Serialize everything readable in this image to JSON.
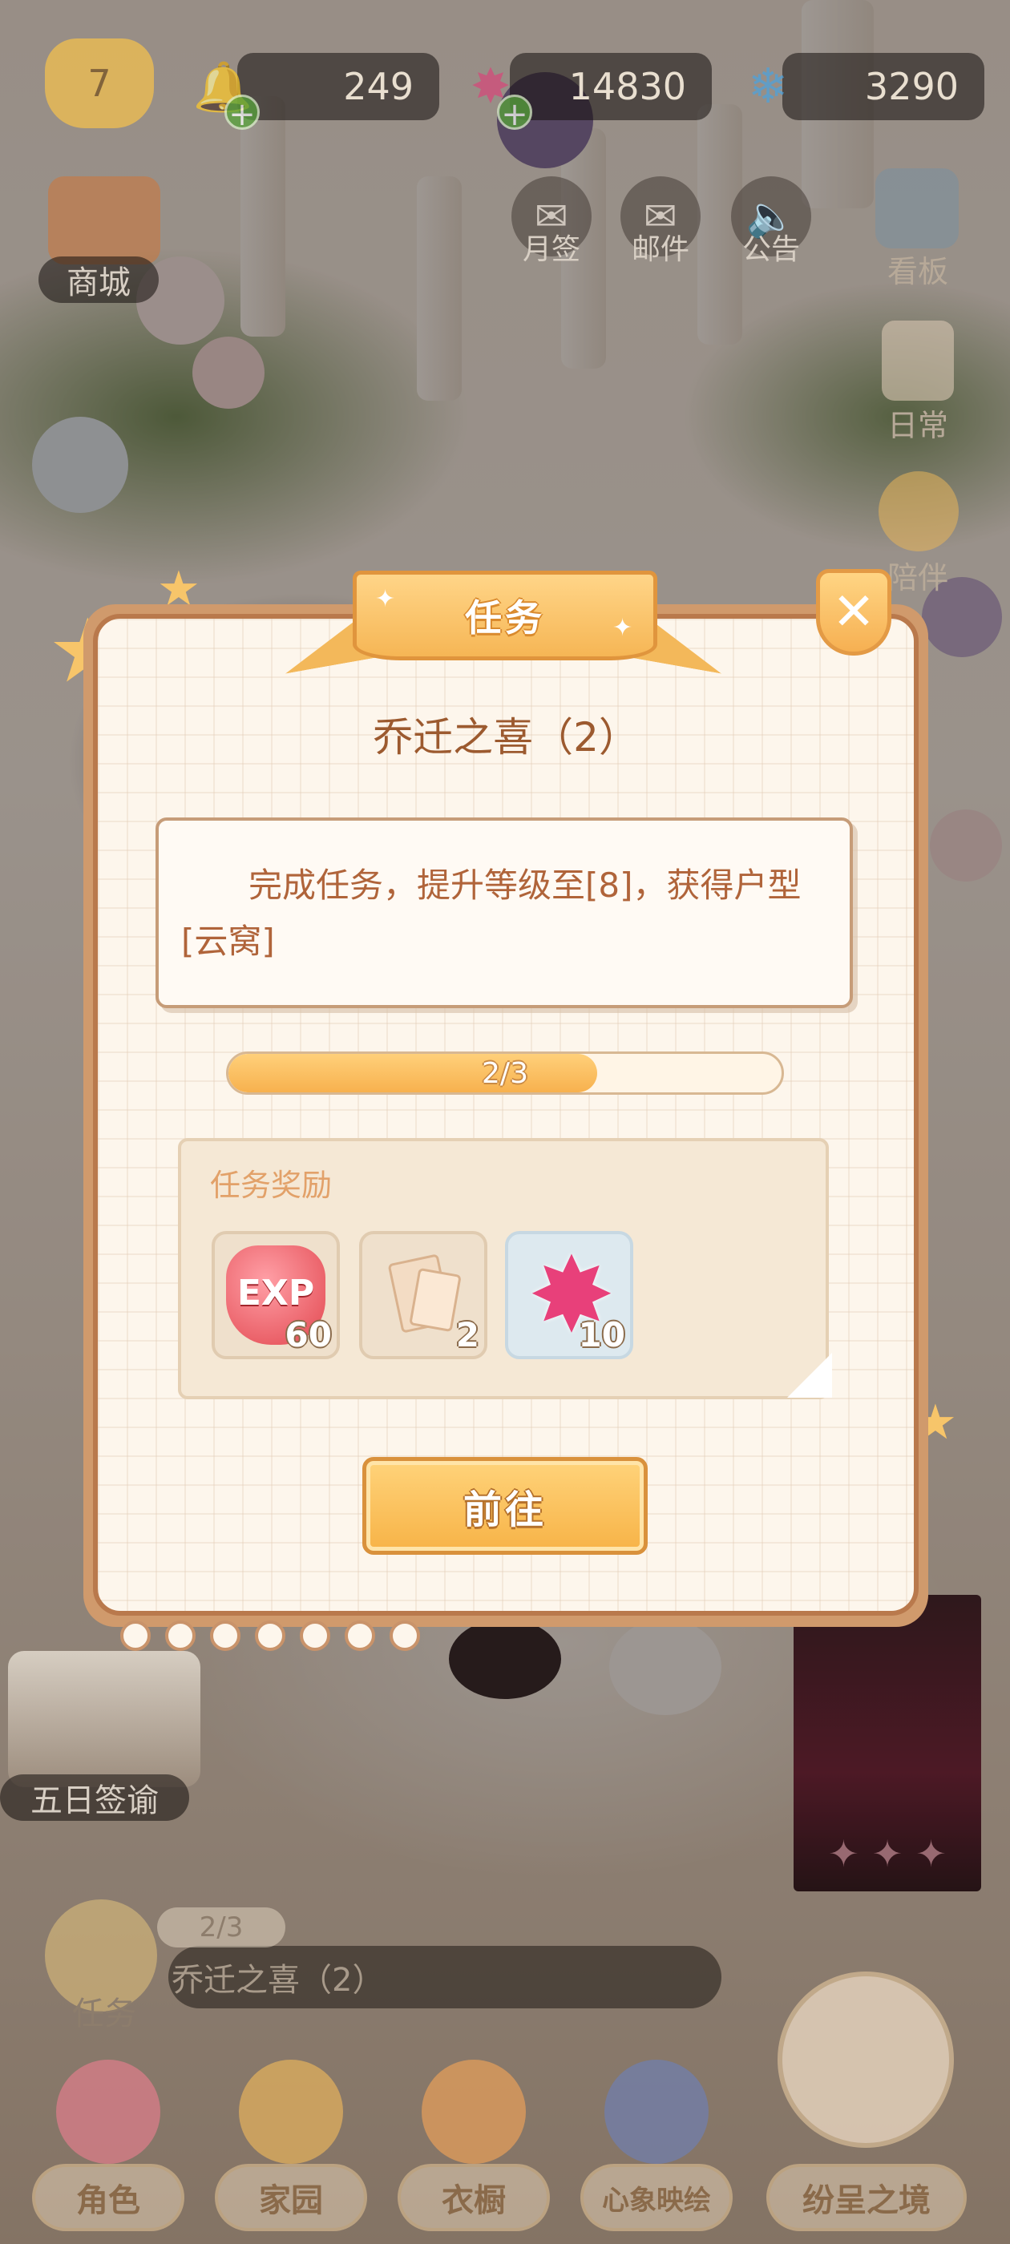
{
  "hud": {
    "level": "7",
    "bell_count": "249",
    "gem_count": "14830",
    "snow_count": "3290"
  },
  "top_buttons": {
    "shop_label": "商城",
    "monthly_sign_label": "月签",
    "mail_label": "邮件",
    "notice_label": "公告",
    "board_label": "看板",
    "daily_label": "日常",
    "companion_label": "陪伴"
  },
  "side": {
    "five_day_sign_label": "五日签谕",
    "quest_label": "任务",
    "quest_progress": "2/3",
    "quest_name": "乔迁之喜（2）"
  },
  "bottom_nav": [
    {
      "label": "角色"
    },
    {
      "label": "家园"
    },
    {
      "label": "衣橱"
    },
    {
      "label": "心象映绘"
    },
    {
      "label": "纷呈之境"
    }
  ],
  "modal": {
    "header": "任务",
    "title": "乔迁之喜（2）",
    "description": "完成任务，提升等级至[8]，获得户型[云窝]",
    "progress_text": "2/3",
    "progress_fraction": 0.667,
    "rewards_title": "任务奖励",
    "rewards": [
      {
        "icon": "exp-icon",
        "label": "EXP",
        "count": "60"
      },
      {
        "icon": "paper-item-icon",
        "count": "2"
      },
      {
        "icon": "pink-star-gem-icon",
        "count": "10"
      }
    ],
    "go_label": "前往",
    "close_symbol": "✕"
  },
  "colors": {
    "accent_orange": "#f6b655",
    "text_brown": "#9c5a2f",
    "frame_brown": "#b9794c"
  }
}
